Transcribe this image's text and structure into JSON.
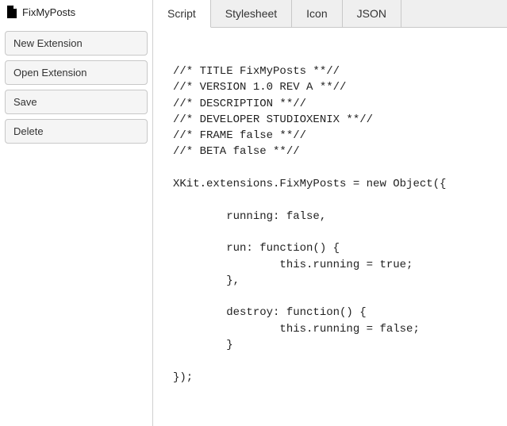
{
  "sidebar": {
    "fileName": "FixMyPosts",
    "buttons": {
      "newExtension": "New Extension",
      "openExtension": "Open Extension",
      "save": "Save",
      "delete": "Delete"
    }
  },
  "tabs": {
    "script": "Script",
    "stylesheet": "Stylesheet",
    "icon": "Icon",
    "json": "JSON"
  },
  "code": "//* TITLE FixMyPosts **//\n//* VERSION 1.0 REV A **//\n//* DESCRIPTION **//\n//* DEVELOPER STUDIOXENIX **//\n//* FRAME false **//\n//* BETA false **//\n\nXKit.extensions.FixMyPosts = new Object({\n\n        running: false,\n\n        run: function() {\n                this.running = true;\n        },\n\n        destroy: function() {\n                this.running = false;\n        }\n\n});"
}
